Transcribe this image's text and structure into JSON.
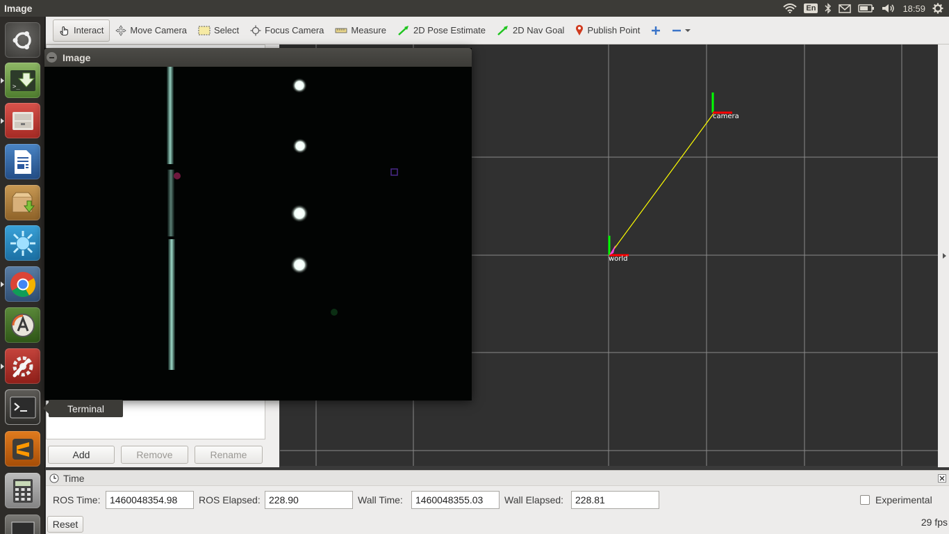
{
  "top_panel": {
    "app_title": "Image",
    "keyboard_layout": "En",
    "clock": "18:59"
  },
  "toolbar": {
    "interact": "Interact",
    "move_camera": "Move Camera",
    "select": "Select",
    "focus_camera": "Focus Camera",
    "measure": "Measure",
    "pose_estimate": "2D Pose Estimate",
    "nav_goal": "2D Nav Goal",
    "publish_point": "Publish Point"
  },
  "displays_panel": {
    "add_label": "Add",
    "remove_label": "Remove",
    "rename_label": "Rename"
  },
  "image_window": {
    "title": "Image"
  },
  "launcher": {
    "tooltip": "Terminal"
  },
  "view3d": {
    "frames": {
      "camera": "camera",
      "world": "world"
    }
  },
  "time_panel": {
    "title": "Time",
    "ros_time_label": "ROS Time:",
    "ros_time_value": "1460048354.98",
    "ros_elapsed_label": "ROS Elapsed:",
    "ros_elapsed_value": "228.90",
    "wall_time_label": "Wall Time:",
    "wall_time_value": "1460048355.03",
    "wall_elapsed_label": "Wall Elapsed:",
    "wall_elapsed_value": "228.81",
    "experimental_label": "Experimental",
    "reset_label": "Reset",
    "fps": "29 fps"
  },
  "colors": {
    "panel_bg": "#3c3b37",
    "view_bg": "#303030",
    "grid": "#a0a0a0",
    "axis_x": "#ff0000",
    "axis_y": "#00ff00",
    "tf_link": "#ffff00"
  }
}
